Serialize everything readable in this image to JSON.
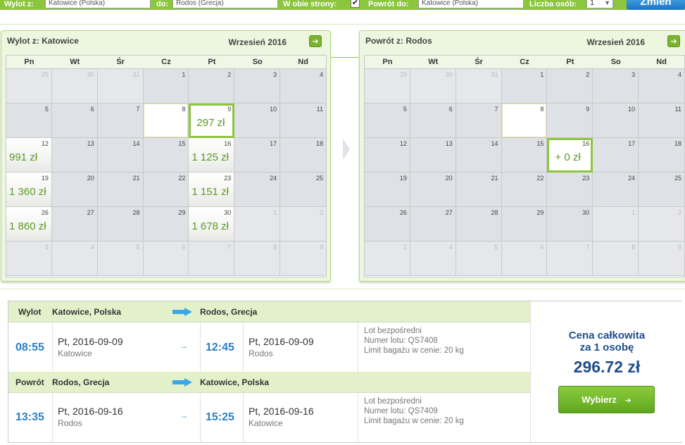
{
  "search": {
    "from_label": "Wylot z:",
    "from_value": "Katowice (Polska)",
    "to_label": "do:",
    "to_value": "Rodos (Grecja)",
    "roundtrip_label": "W obie strony:",
    "roundtrip_checked": "✔",
    "return_label": "Powrót do:",
    "return_value": "Katowice (Polska)",
    "persons_label": "Liczba osób:",
    "persons_value": "1",
    "change_button": "Zmień"
  },
  "weekdays": [
    "Pn",
    "Wt",
    "Śr",
    "Cz",
    "Pt",
    "So",
    "Nd"
  ],
  "outbound_calendar": {
    "title_prefix": "Wylot z:",
    "title_city": "Katowice",
    "month": "Wrzesień 2016",
    "weeks": [
      [
        {
          "d": "29",
          "o": true
        },
        {
          "d": "30",
          "o": true
        },
        {
          "d": "31",
          "o": true
        },
        {
          "d": "1"
        },
        {
          "d": "2"
        },
        {
          "d": "3"
        },
        {
          "d": "4"
        }
      ],
      [
        {
          "d": "5"
        },
        {
          "d": "6"
        },
        {
          "d": "7"
        },
        {
          "d": "8",
          "hl": true
        },
        {
          "d": "9",
          "p": "297 zł",
          "sel": true
        },
        {
          "d": "10"
        },
        {
          "d": "11"
        }
      ],
      [
        {
          "d": "12",
          "p": "991 zł"
        },
        {
          "d": "13"
        },
        {
          "d": "14"
        },
        {
          "d": "15"
        },
        {
          "d": "16",
          "p": "1 125 zł"
        },
        {
          "d": "17"
        },
        {
          "d": "18"
        }
      ],
      [
        {
          "d": "19",
          "p": "1 360 zł"
        },
        {
          "d": "20"
        },
        {
          "d": "21"
        },
        {
          "d": "22"
        },
        {
          "d": "23",
          "p": "1 151 zł"
        },
        {
          "d": "24"
        },
        {
          "d": "25"
        }
      ],
      [
        {
          "d": "26",
          "p": "1 860 zł"
        },
        {
          "d": "27"
        },
        {
          "d": "28"
        },
        {
          "d": "29"
        },
        {
          "d": "30",
          "p": "1 678 zł"
        },
        {
          "d": "1",
          "o": true
        },
        {
          "d": "2",
          "o": true
        }
      ],
      [
        {
          "d": "3",
          "o": true
        },
        {
          "d": "4",
          "o": true
        },
        {
          "d": "5",
          "o": true
        },
        {
          "d": "6",
          "o": true
        },
        {
          "d": "7",
          "o": true
        },
        {
          "d": "8",
          "o": true
        },
        {
          "d": "9",
          "o": true
        }
      ]
    ]
  },
  "return_calendar": {
    "title_prefix": "Powrót z:",
    "title_city": "Rodos",
    "month": "Wrzesień 2016",
    "weeks": [
      [
        {
          "d": "29",
          "o": true
        },
        {
          "d": "30",
          "o": true
        },
        {
          "d": "31",
          "o": true
        },
        {
          "d": "1"
        },
        {
          "d": "2"
        },
        {
          "d": "3"
        },
        {
          "d": "4"
        }
      ],
      [
        {
          "d": "5"
        },
        {
          "d": "6"
        },
        {
          "d": "7"
        },
        {
          "d": "8",
          "hl": true
        },
        {
          "d": "9"
        },
        {
          "d": "10"
        },
        {
          "d": "11"
        }
      ],
      [
        {
          "d": "12"
        },
        {
          "d": "13"
        },
        {
          "d": "14"
        },
        {
          "d": "15"
        },
        {
          "d": "16",
          "p": "+ 0 zł",
          "sel": true
        },
        {
          "d": "17"
        },
        {
          "d": "18"
        }
      ],
      [
        {
          "d": "19"
        },
        {
          "d": "20"
        },
        {
          "d": "21"
        },
        {
          "d": "22"
        },
        {
          "d": "23"
        },
        {
          "d": "24"
        },
        {
          "d": "25"
        }
      ],
      [
        {
          "d": "26"
        },
        {
          "d": "27"
        },
        {
          "d": "28"
        },
        {
          "d": "29"
        },
        {
          "d": "30"
        },
        {
          "d": "1",
          "o": true
        },
        {
          "d": "2",
          "o": true
        }
      ],
      [
        {
          "d": "3",
          "o": true
        },
        {
          "d": "4",
          "o": true
        },
        {
          "d": "5",
          "o": true
        },
        {
          "d": "6",
          "o": true
        },
        {
          "d": "7",
          "o": true
        },
        {
          "d": "8",
          "o": true
        },
        {
          "d": "9",
          "o": true
        }
      ]
    ]
  },
  "outbound_leg": {
    "label": "Wylot",
    "from": "Katowice, Polska",
    "to": "Rodos, Grecja",
    "dep_time": "08:55",
    "dep_day": "Pt,",
    "dep_date": "2016-09-09",
    "dep_city": "Katowice",
    "arr_time": "12:45",
    "arr_day": "Pt,",
    "arr_date": "2016-09-09",
    "arr_city": "Rodos",
    "info_direct": "Lot bezpośredni",
    "info_flight": "Numer lotu: QS7408",
    "info_bag": "Limit bagażu w cenie: 20 kg"
  },
  "return_leg": {
    "label": "Powrót",
    "from": "Rodos, Grecja",
    "to": "Katowice, Polska",
    "dep_time": "13:35",
    "dep_day": "Pt,",
    "dep_date": "2016-09-16",
    "dep_city": "Rodos",
    "arr_time": "15:25",
    "arr_day": "Pt,",
    "arr_date": "2016-09-16",
    "arr_city": "Katowice",
    "info_direct": "Lot bezpośredni",
    "info_flight": "Numer lotu: QS7409",
    "info_bag": "Limit bagażu w cenie: 20 kg"
  },
  "price": {
    "label_line1": "Cena całkowita",
    "label_line2": "za 1 osobę",
    "total": "296.72 zł",
    "choose_button": "Wybierz",
    "choose_icon": "➔"
  },
  "icons": {
    "next_month": "arrow-right-icon",
    "small_arrow": "→"
  },
  "colors": {
    "accent_green": "#8cc63f",
    "price_green": "#5b9a22",
    "time_blue": "#2a80c8",
    "price_navy": "#1f4e8c"
  }
}
